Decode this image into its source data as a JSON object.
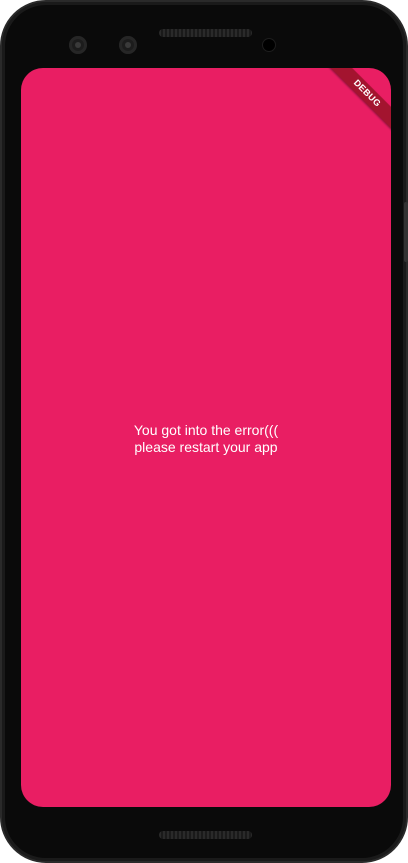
{
  "colors": {
    "screen_background": "#e91e63",
    "bezel": "#0a0a0a",
    "banner": "#a3142f",
    "text": "#ffffff"
  },
  "debug_banner": {
    "label": "DEBUG"
  },
  "error": {
    "line1": "You got into the error(((",
    "line2": "please restart your app"
  }
}
